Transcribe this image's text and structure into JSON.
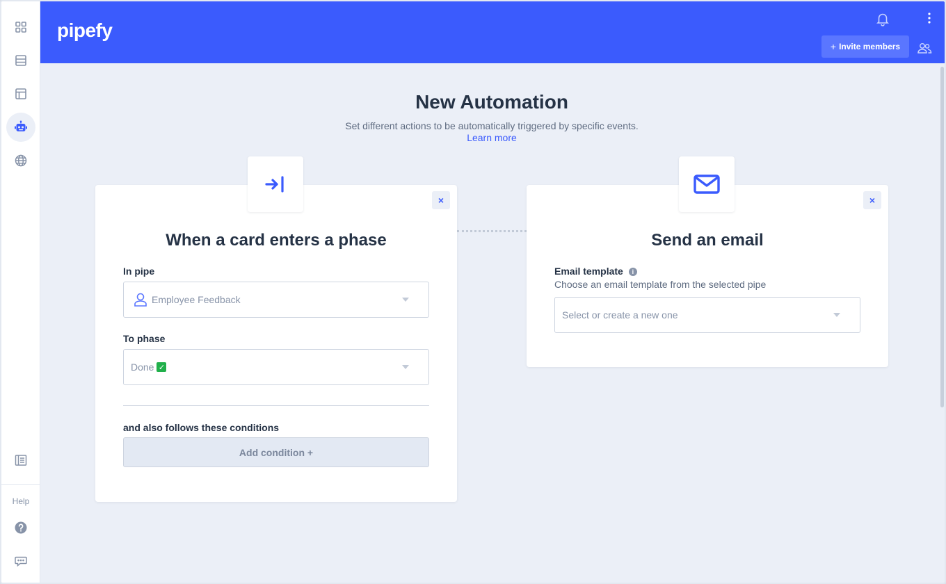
{
  "app": {
    "logo_text": "pipefy"
  },
  "header": {
    "invite_label": "Invite members",
    "invite_plus": "+"
  },
  "sidebar": {
    "items": [
      {
        "icon": "apps-grid-icon"
      },
      {
        "icon": "database-icon"
      },
      {
        "icon": "portal-icon"
      },
      {
        "icon": "automation-robot-icon",
        "active": true
      },
      {
        "icon": "globe-icon"
      }
    ],
    "bottom_icon": "reports-icon",
    "help_label": "Help",
    "help_icon": "question-circle-icon",
    "chat_icon": "chat-icon"
  },
  "page": {
    "title": "New Automation",
    "subtitle": "Set different actions to be automatically triggered by specific events.",
    "learn_more": "Learn more"
  },
  "trigger_card": {
    "icon": "enter-phase-icon",
    "title": "When a card enters a phase",
    "close": "×",
    "pipe_label": "In pipe",
    "pipe_value": "Employee Feedback",
    "phase_label": "To phase",
    "phase_value": "Done",
    "phase_emoji": "✓",
    "conditions_label": "and also follows these conditions",
    "add_condition": "Add condition +"
  },
  "action_card": {
    "icon": "envelope-icon",
    "title": "Send an email",
    "close": "×",
    "template_label": "Email template",
    "template_info": "i",
    "template_hint": "Choose an email template from the selected pipe",
    "template_placeholder": "Select or create a new one"
  },
  "colors": {
    "brand": "#3b5bfd",
    "background": "#ebeff7",
    "text": "#253245"
  }
}
